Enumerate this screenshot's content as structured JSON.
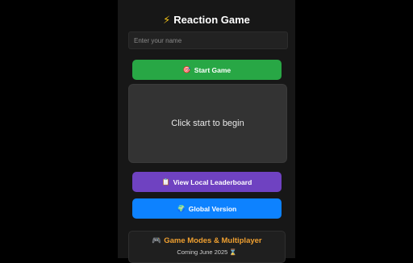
{
  "header": {
    "title_icon": "lightning-icon",
    "title_emoji": "⚡",
    "title": "Reaction Game"
  },
  "name_input": {
    "placeholder": "Enter your name",
    "value": ""
  },
  "buttons": {
    "start": {
      "icon": "target-icon",
      "emoji": "🎯",
      "label": "Start Game",
      "color": "#28a745"
    },
    "leaderboard": {
      "icon": "clipboard-icon",
      "emoji": "📋",
      "label": "View Local Leaderboard",
      "color": "#6f42c1"
    },
    "global": {
      "icon": "globe-icon",
      "emoji": "🌍",
      "label": "Global Version",
      "color": "#0d82ff"
    }
  },
  "game_area": {
    "message": "Click start to begin"
  },
  "modes_card": {
    "icon": "gamepad-icon",
    "emoji": "🎮",
    "title": "Game Modes & Multiplayer",
    "subtitle": "Coming June 2025",
    "subtitle_icon": "hourglass-icon",
    "subtitle_emoji": "⌛"
  },
  "colors": {
    "page_background": "#000000",
    "panel_background": "#171717",
    "game_area_background": "#333333",
    "accent_orange": "#f0a030"
  }
}
